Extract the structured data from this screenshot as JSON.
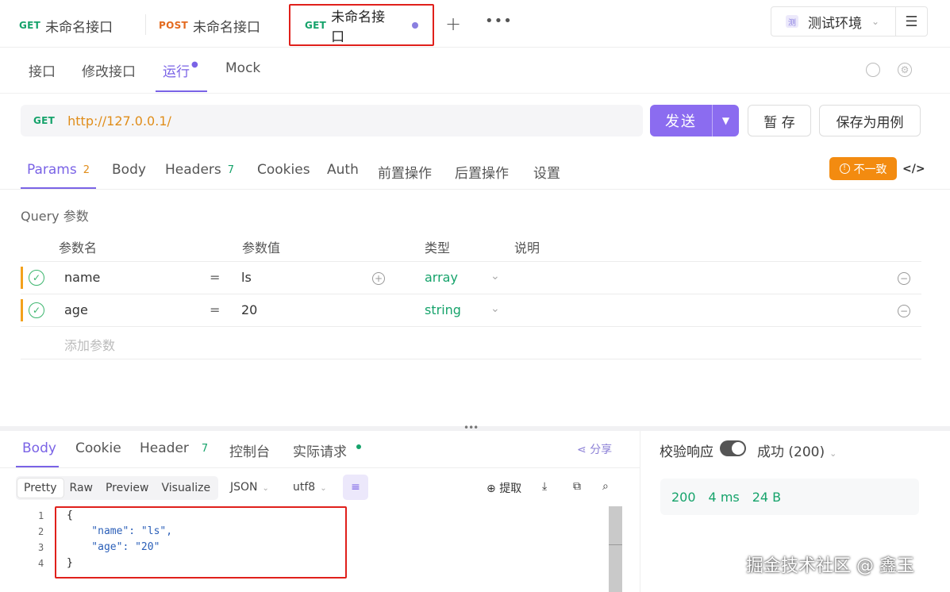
{
  "tabs": [
    {
      "method": "GET",
      "title": "未命名接口"
    },
    {
      "method": "POST",
      "title": "未命名接口"
    },
    {
      "method": "GET",
      "title": "未命名接口"
    }
  ],
  "env": {
    "badge": "测",
    "label": "测试环境"
  },
  "sub_tabs": [
    "接口",
    "修改接口",
    "运行",
    "Mock"
  ],
  "url": {
    "method": "GET",
    "value": "http://127.0.0.1/"
  },
  "buttons": {
    "send": "发送",
    "save_temp": "暂 存",
    "save_case": "保存为用例"
  },
  "request_tabs": [
    {
      "label": "Params",
      "count": "2"
    },
    {
      "label": "Body"
    },
    {
      "label": "Headers",
      "count": "7"
    },
    {
      "label": "Cookies"
    },
    {
      "label": "Auth"
    },
    {
      "label": "前置操作"
    },
    {
      "label": "后置操作"
    },
    {
      "label": "设置"
    }
  ],
  "warning": "不一致",
  "query": {
    "section_label": "Query 参数",
    "headers": [
      "参数名",
      "参数值",
      "类型",
      "说明"
    ],
    "rows": [
      {
        "name": "name",
        "eq": "=",
        "value": "ls",
        "type": "array"
      },
      {
        "name": "age",
        "eq": "=",
        "value": "20",
        "type": "string"
      }
    ],
    "add_placeholder": "添加参数"
  },
  "response": {
    "tabs": [
      {
        "label": "Body"
      },
      {
        "label": "Cookie"
      },
      {
        "label": "Header",
        "count": "7"
      },
      {
        "label": "控制台"
      },
      {
        "label": "实际请求"
      }
    ],
    "share": "分享",
    "views": [
      "Pretty",
      "Raw",
      "Preview",
      "Visualize"
    ],
    "format": "JSON",
    "encoding": "utf8",
    "extract": "提取",
    "code_lines": [
      "{",
      "    \"name\": \"ls\",",
      "    \"age\": \"20\"",
      "}"
    ],
    "line_numbers": [
      "1",
      "2",
      "3",
      "4"
    ]
  },
  "validate": {
    "label": "校验响应",
    "result": "成功 (200)"
  },
  "stats": {
    "status": "200",
    "time": "4 ms",
    "size": "24 B"
  },
  "watermark": "掘金技术社区 @ 鑫玉"
}
